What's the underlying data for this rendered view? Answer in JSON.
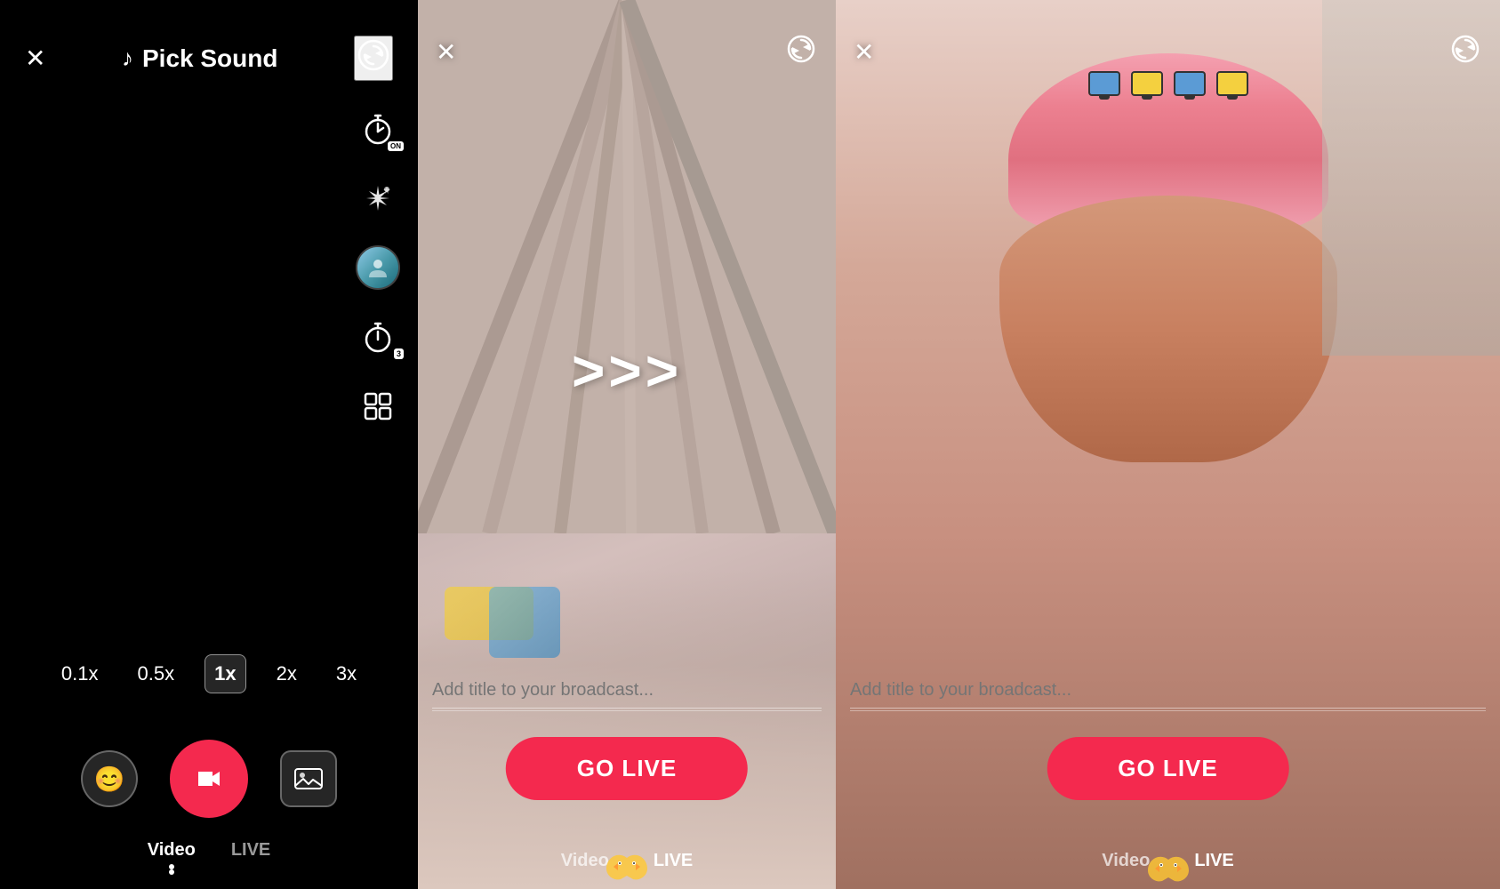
{
  "left": {
    "close_label": "✕",
    "pick_sound_label": "Pick Sound",
    "music_icon": "♪",
    "refresh_icon": "↻",
    "icons": [
      {
        "name": "timer-on-icon",
        "symbol": "⏱",
        "badge": "ON"
      },
      {
        "name": "effects-icon",
        "symbol": "✦"
      },
      {
        "name": "avatar-icon",
        "symbol": ""
      },
      {
        "name": "countdown-icon",
        "symbol": "⏲",
        "badge": "3"
      },
      {
        "name": "grid-icon",
        "symbol": "⊞"
      }
    ],
    "speeds": [
      {
        "label": "0.1x",
        "active": false
      },
      {
        "label": "0.5x",
        "active": false
      },
      {
        "label": "1x",
        "active": true
      },
      {
        "label": "2x",
        "active": false
      },
      {
        "label": "3x",
        "active": false
      }
    ],
    "emoji_btn": "😊",
    "gallery_icon": "🏞",
    "mode_tabs": [
      {
        "label": "Video",
        "active": true
      },
      {
        "label": "LIVE",
        "active": false
      }
    ]
  },
  "center": {
    "close_icon": "✕",
    "refresh_icon": "↻",
    "arrows": ">>>",
    "broadcast_placeholder": "Add title to your broadcast...",
    "go_live_label": "GO LIVE",
    "tabs": [
      {
        "label": "Video",
        "active": false
      },
      {
        "label": "LIVE",
        "active": true
      }
    ]
  },
  "right": {
    "close_icon": "✕",
    "refresh_icon": "↻",
    "broadcast_placeholder": "Add title to your broadcast...",
    "go_live_label": "GO LIVE",
    "tabs": [
      {
        "label": "Video",
        "active": false
      },
      {
        "label": "LIVE",
        "active": true
      }
    ]
  },
  "colors": {
    "accent": "#f4294e",
    "bg": "#000000",
    "white": "#ffffff"
  }
}
